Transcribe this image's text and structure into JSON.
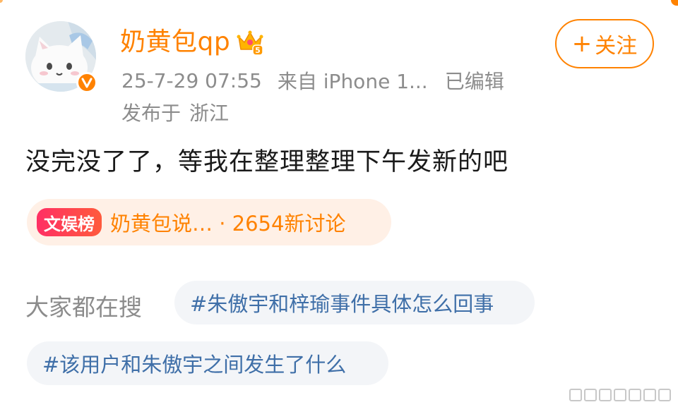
{
  "user": {
    "name": "奶黄包qp",
    "timestamp": "25-7-29 07:55",
    "source": "来自 iPhone 1...",
    "edited": "已编辑",
    "location_prefix": "发布于",
    "location": "浙江"
  },
  "follow_button": {
    "plus": "+",
    "label": "关注"
  },
  "post": {
    "text": "没完没了了，等我在整理整理下午发新的吧"
  },
  "rank_tag": {
    "chip": "文娱榜",
    "text": "奶黄包说… · 2654新讨论"
  },
  "search": {
    "label": "大家都在搜",
    "topics": [
      "#朱傲宇和梓瑜事件具体怎么回事",
      "#该用户和朱傲宇之间发生了什么"
    ]
  },
  "colors": {
    "accent": "#ff8200",
    "topic": "#3f6fa8",
    "meta": "#8c8c8c",
    "rank_chip": "#ff2f64"
  }
}
